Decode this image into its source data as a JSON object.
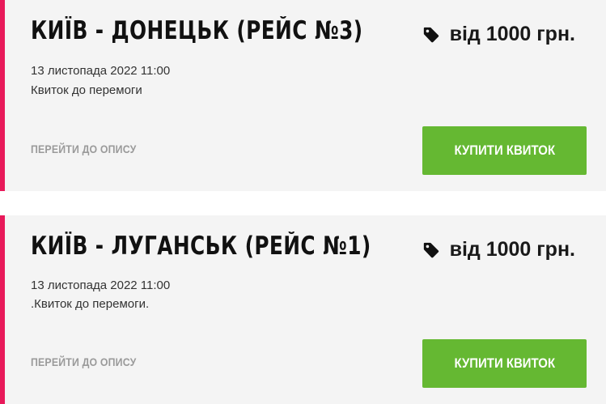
{
  "trips": [
    {
      "title": "КИЇВ - ДОНЕЦЬК (РЕЙС №3)",
      "price": "від 1000 грн.",
      "date": "13 листопада 2022 11:00",
      "description": "Квиток до перемоги",
      "details_label": "ПЕРЕЙТИ ДО ОПИСУ",
      "buy_label": "КУПИТИ КВИТОК"
    },
    {
      "title": "КИЇВ - ЛУГАНСЬК (РЕЙС №1)",
      "price": "від 1000 грн.",
      "date": "13 листопада 2022 11:00",
      "description": ".Квиток до перемоги.",
      "details_label": "ПЕРЕЙТИ ДО ОПИСУ",
      "buy_label": "КУПИТИ КВИТОК"
    }
  ],
  "colors": {
    "accent": "#e8195a",
    "card_background": "#f4f4f4",
    "buy_button": "#65b832",
    "details_link": "#9a9a9a"
  },
  "icons": {
    "price": "price-tag-icon"
  }
}
